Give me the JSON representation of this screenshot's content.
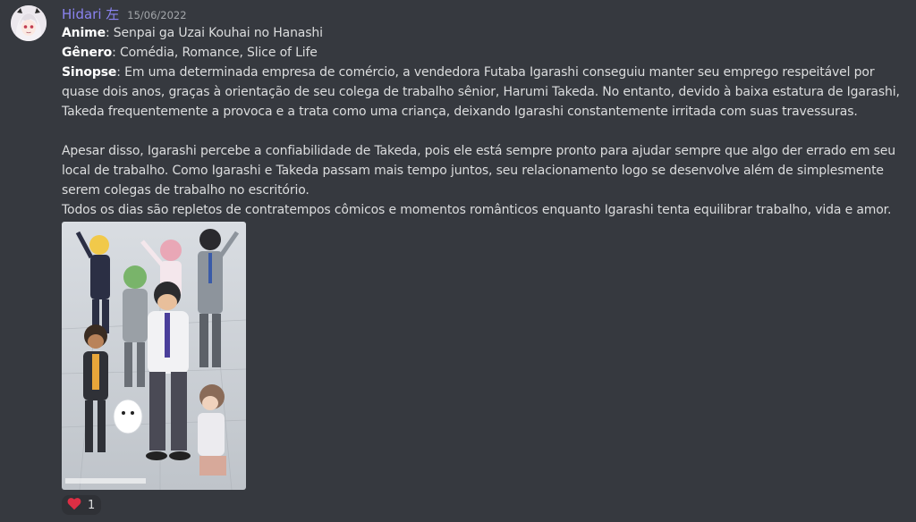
{
  "message": {
    "author": "Hidari 左",
    "timestamp": "15/06/2022",
    "anime_label": "Anime",
    "anime_value": ": Senpai ga Uzai Kouhai no Hanashi",
    "genre_label": "Gênero",
    "genre_value": ": Comédia, Romance, Slice of Life",
    "synopsis_label": "Sinopse",
    "synopsis_value": ": Em uma determinada empresa de comércio, a vendedora Futaba Igarashi conseguiu manter seu emprego respeitável por quase dois anos, graças à orientação de seu colega de trabalho sênior, Harumi Takeda. No entanto, devido à baixa estatura de Igarashi, Takeda frequentemente a provoca e a trata como uma criança, deixando Igarashi constantemente irritada com suas travessuras.",
    "paragraph_2": "Apesar disso, Igarashi percebe a confiabilidade de Takeda, pois ele está sempre pronto para ajudar sempre que algo der errado em seu local de trabalho. Como Igarashi e Takeda passam mais tempo juntos, seu relacionamento logo se desenvolve além de simplesmente serem colegas de trabalho no escritório.",
    "paragraph_3": "Todos os dias são repletos de contratempos cômicos e momentos românticos enquanto Igarashi tenta equilibrar trabalho, vida e amor."
  },
  "reaction": {
    "emoji_icon": "heart-icon",
    "count": "1",
    "color": "#dd2e44"
  },
  "colors": {
    "background": "#36393f",
    "username": "#8a83f0",
    "text": "#dcddde"
  }
}
